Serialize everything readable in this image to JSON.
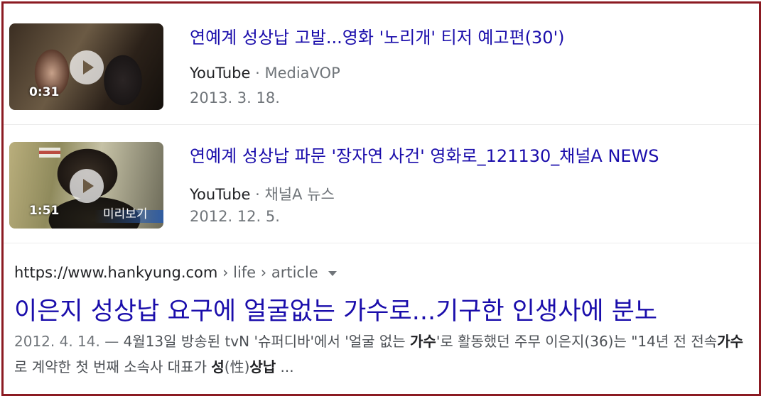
{
  "results": {
    "videos": [
      {
        "title": "연예계 성상납 고발...영화 '노리개' 티저 예고편(30')",
        "duration": "0:31",
        "source": "YouTube",
        "separator": "·",
        "channel": "MediaVOP",
        "date": "2013. 3. 18."
      },
      {
        "title": "연예계 성상납 파문 '장자연 사건' 영화로_121130_채널A NEWS",
        "duration": "1:51",
        "overlay_text": "미리보기",
        "source": "YouTube",
        "separator": "·",
        "channel": "채널A 뉴스",
        "date": "2012. 12. 5."
      }
    ],
    "web": {
      "url": "https://www.hankyung.com",
      "breadcrumbs": " › life › article",
      "title": "이은지 성상납 요구에 얼굴없는 가수로...기구한 인생사에 분노",
      "snippet": {
        "date": "2012. 4. 14.",
        "dash": " — ",
        "p1": "4월13일 방송된 tvN '슈퍼디바'에서 '얼굴 없는 ",
        "b1": "가수",
        "p2": "'로 활동했던 주무 이은지(36)는 \"14년 전 전속",
        "b2": "가수",
        "p3": "로 계약한 첫 번째 소속사 대표가 ",
        "b3": "성",
        "p4": "(性)",
        "b4": "상납",
        "p5": " ..."
      }
    }
  },
  "colors": {
    "frame_border": "#8b1a22",
    "link": "#1a0dab",
    "meta": "#70757a",
    "text": "#202124",
    "snippet": "#4d5156"
  },
  "icons": [
    "play-icon",
    "dropdown-caret-icon"
  ]
}
